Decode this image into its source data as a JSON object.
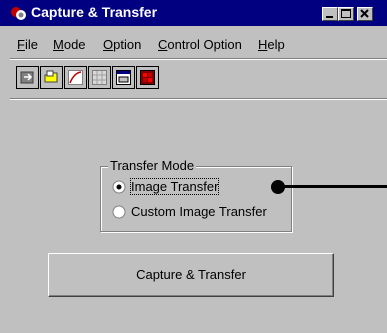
{
  "window": {
    "title": "Capture & Transfer",
    "icon": "capture-app-icon",
    "controls": [
      "minimize-icon",
      "maximize-icon",
      "close-icon"
    ]
  },
  "menu": {
    "items": [
      {
        "key": "F",
        "rest": "ile"
      },
      {
        "key": "M",
        "rest": "ode"
      },
      {
        "key": "O",
        "rest": "ption"
      },
      {
        "key": "C",
        "rest": "ontrol Option"
      },
      {
        "key": "H",
        "rest": "elp"
      }
    ]
  },
  "toolbar": {
    "icons": [
      "export-icon",
      "open-folder-icon",
      "curve-icon",
      "grid-icon",
      "window-icon",
      "palette-icon"
    ]
  },
  "transfer_mode": {
    "label": "Transfer Mode",
    "options": [
      {
        "label": "Image Transfer",
        "selected": true
      },
      {
        "label": "Custom Image Transfer",
        "selected": false
      }
    ]
  },
  "capture_button": {
    "label": "Capture & Transfer"
  },
  "colors": {
    "titlebar": "#000080",
    "face": "#c0c0c0"
  }
}
